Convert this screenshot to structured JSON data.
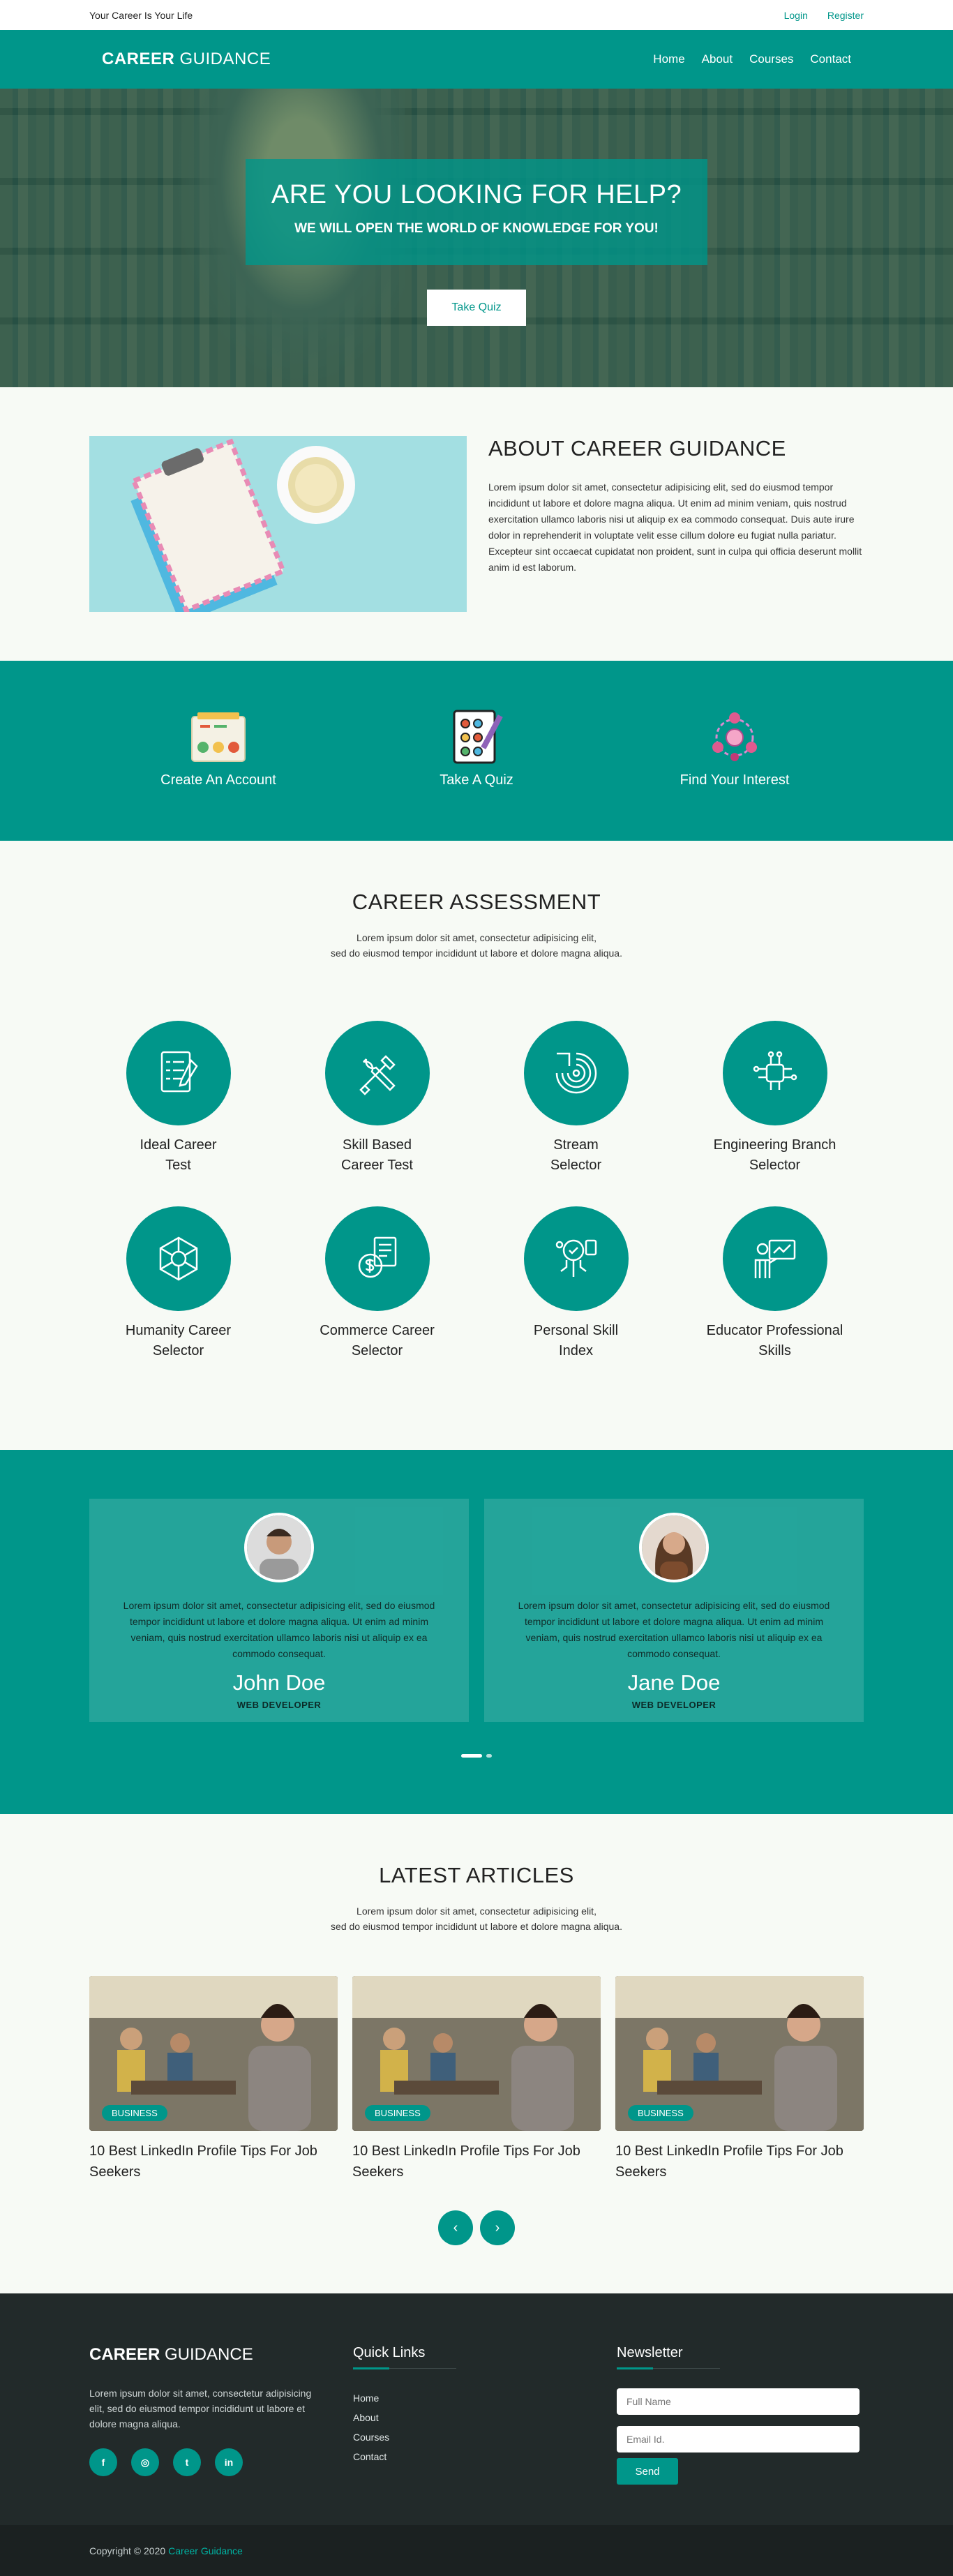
{
  "topbar": {
    "tagline": "Your Career Is Your Life",
    "login": "Login",
    "register": "Register"
  },
  "nav": {
    "logo_bold": "CAREER",
    "logo_light": "GUIDANCE",
    "items": [
      "Home",
      "About",
      "Courses",
      "Contact"
    ]
  },
  "hero": {
    "title": "ARE YOU LOOKING FOR HELP?",
    "subtitle": "WE WILL OPEN THE WORLD OF KNOWLEDGE FOR YOU!",
    "button": "Take Quiz"
  },
  "about": {
    "title": "ABOUT CAREER GUIDANCE",
    "text": "Lorem ipsum dolor sit amet, consectetur adipisicing elit, sed do eiusmod tempor incididunt ut labore et dolore magna aliqua. Ut enim ad minim veniam, quis nostrud exercitation ullamco laboris nisi ut aliquip ex ea commodo consequat. Duis aute irure dolor in reprehenderit in voluptate velit esse cillum dolore eu fugiat nulla pariatur. Excepteur sint occaecat cupidatat non proident, sunt in culpa qui officia deserunt mollit anim id est laborum."
  },
  "steps": [
    {
      "label": "Create An Account",
      "icon": "emoji-chart-icon"
    },
    {
      "label": "Take A Quiz",
      "icon": "quiz-board-icon"
    },
    {
      "label": "Find Your Interest",
      "icon": "interest-network-icon"
    }
  ],
  "assessment": {
    "title": "CAREER ASSESSMENT",
    "sub_line1": "Lorem ipsum dolor sit amet, consectetur adipisicing elit,",
    "sub_line2": "sed do eiusmod tempor incididunt ut labore et dolore magna aliqua.",
    "cards": [
      {
        "line1": "Ideal Career",
        "line2": "Test",
        "icon": "checklist-icon"
      },
      {
        "line1": "Skill Based",
        "line2": "Career Test",
        "icon": "tools-icon"
      },
      {
        "line1": "Stream",
        "line2": "Selector",
        "icon": "target-icon"
      },
      {
        "line1": "Engineering Branch",
        "line2": "Selector",
        "icon": "circuit-icon"
      },
      {
        "line1": "Humanity Career",
        "line2": "Selector",
        "icon": "globe-network-icon"
      },
      {
        "line1": "Commerce Career",
        "line2": "Selector",
        "icon": "money-document-icon"
      },
      {
        "line1": "Personal Skill",
        "line2": "Index",
        "icon": "brain-skill-icon"
      },
      {
        "line1": "Educator Professional",
        "line2": "Skills",
        "icon": "teacher-board-icon"
      }
    ]
  },
  "testimonials": [
    {
      "text": "Lorem ipsum dolor sit amet, consectetur adipisicing elit, sed do eiusmod tempor incididunt ut labore et dolore magna aliqua. Ut enim ad minim veniam, quis nostrud exercitation ullamco laboris nisi ut aliquip ex ea commodo consequat.",
      "name": "John Doe",
      "role": "WEB DEVELOPER"
    },
    {
      "text": "Lorem ipsum dolor sit amet, consectetur adipisicing elit, sed do eiusmod tempor incididunt ut labore et dolore magna aliqua. Ut enim ad minim veniam, quis nostrud exercitation ullamco laboris nisi ut aliquip ex ea commodo consequat.",
      "name": "Jane Doe",
      "role": "WEB DEVELOPER"
    }
  ],
  "articles": {
    "title": "LATEST ARTICLES",
    "sub_line1": "Lorem ipsum dolor sit amet, consectetur adipisicing elit,",
    "sub_line2": "sed do eiusmod tempor incididunt ut labore et dolore magna aliqua.",
    "items": [
      {
        "badge": "BUSINESS",
        "title": "10 Best LinkedIn Profile Tips For Job Seekers"
      },
      {
        "badge": "BUSINESS",
        "title": "10 Best LinkedIn Profile Tips For Job Seekers"
      },
      {
        "badge": "BUSINESS",
        "title": "10 Best LinkedIn Profile Tips For Job Seekers"
      }
    ],
    "prev": "‹",
    "next": "›"
  },
  "footer": {
    "logo_bold": "CAREER",
    "logo_light": "GUIDANCE",
    "desc": "Lorem ipsum dolor sit amet, consectetur adipisicing elit, sed do eiusmod tempor incididunt ut labore et dolore magna aliqua.",
    "social": [
      "f",
      "◎",
      "t",
      "in"
    ],
    "quick_title": "Quick Links",
    "links": [
      "Home",
      "About",
      "Courses",
      "Contact"
    ],
    "news_title": "Newsletter",
    "name_placeholder": "Full Name",
    "email_placeholder": "Email Id.",
    "send": "Send"
  },
  "copyright": {
    "text": "Copyright © 2020",
    "brand": "Career Guidance"
  },
  "colors": {
    "accent": "#00968a",
    "footer_bg": "#222a2a",
    "page_bg": "#f7faf5"
  }
}
